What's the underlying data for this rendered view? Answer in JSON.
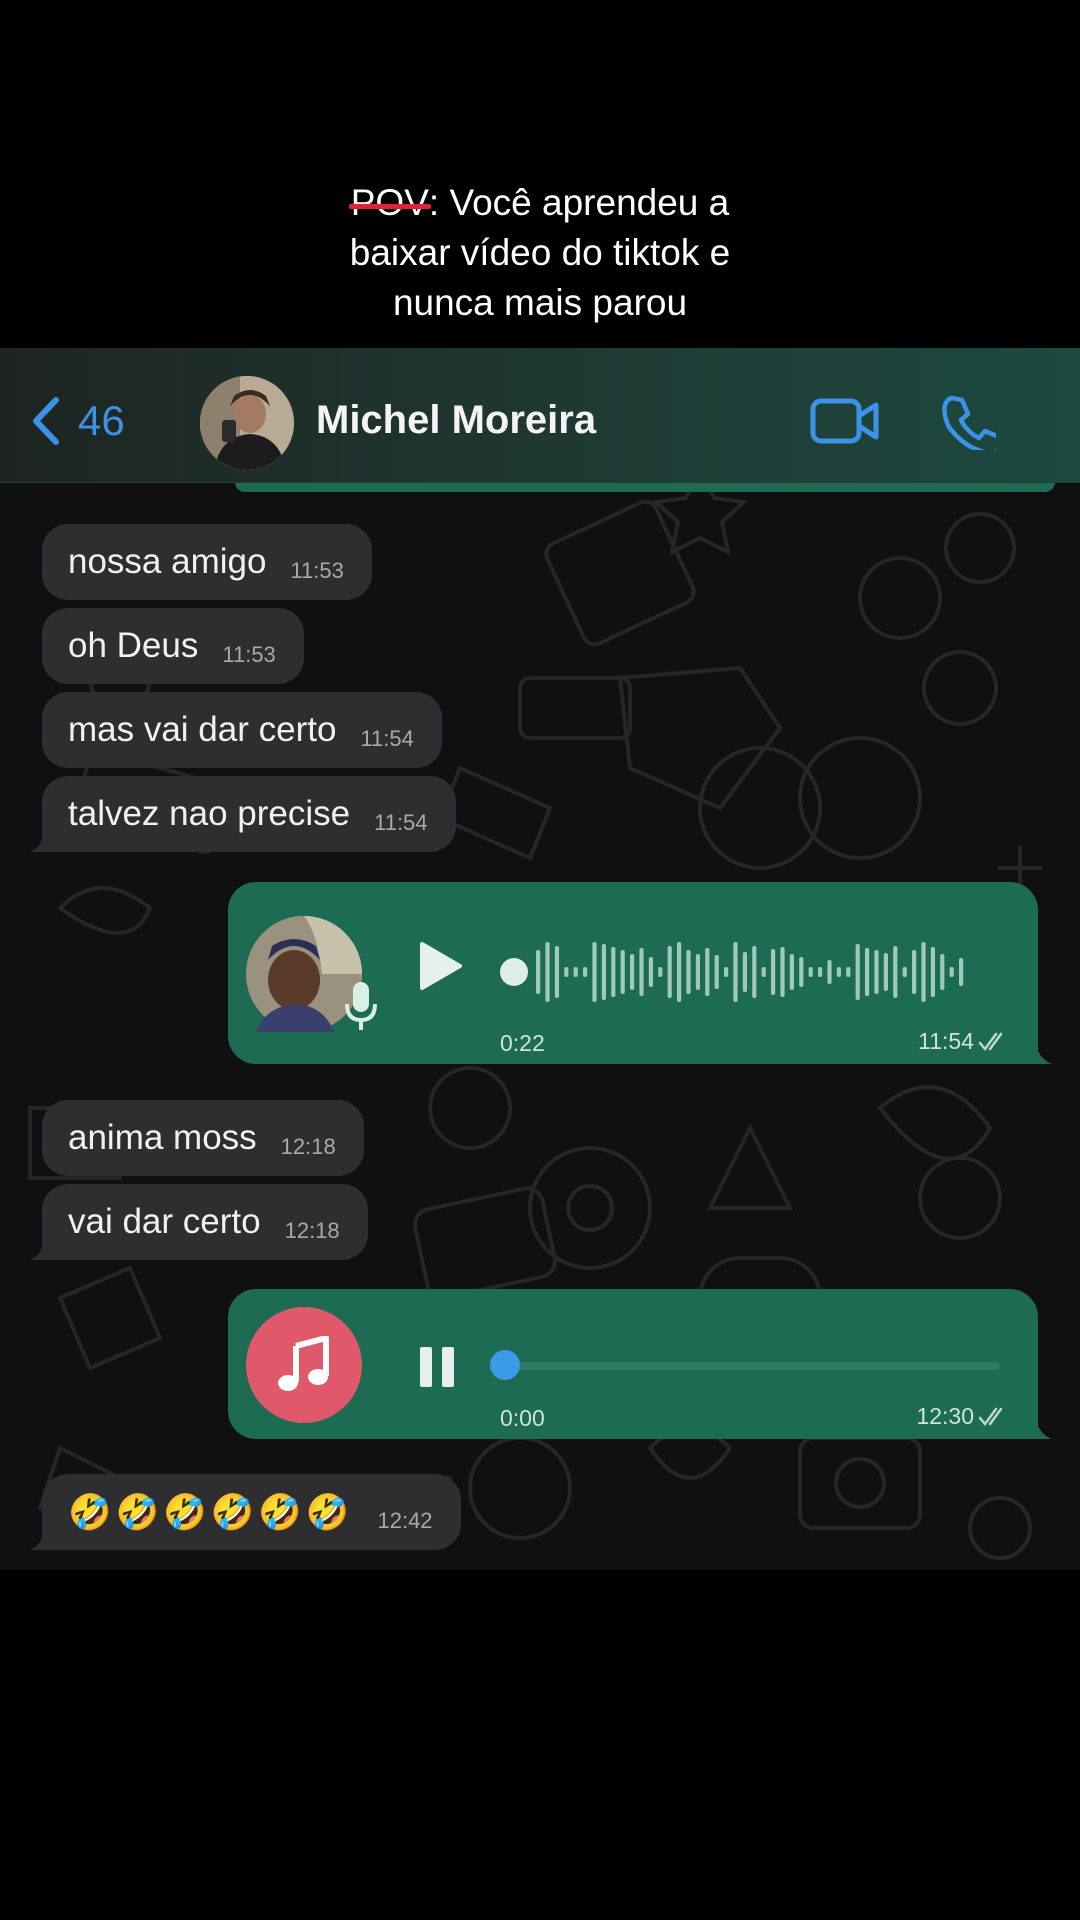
{
  "caption": {
    "strike_word": "POV",
    "line1_rest": ": Você aprendeu a",
    "line2": "baixar vídeo do tiktok e",
    "line3": "nunca mais parou"
  },
  "header": {
    "back_icon": "chevron-left-icon",
    "back_count": "46",
    "contact_name": "Michel Moreira",
    "video_icon": "video-camera-icon",
    "call_icon": "phone-icon",
    "accent": "#3b92e6"
  },
  "messages": {
    "m1": {
      "text": "nossa amigo",
      "time": "11:53"
    },
    "m2": {
      "text": "oh Deus",
      "time": "11:53"
    },
    "m3": {
      "text": "mas vai dar certo",
      "time": "11:54"
    },
    "m4": {
      "text": "talvez nao precise",
      "time": "11:54"
    },
    "voice": {
      "duration": "0:22",
      "time": "11:54",
      "state": "paused",
      "icon": "play-icon"
    },
    "m5": {
      "text": "anima moss",
      "time": "12:18"
    },
    "m6": {
      "text": "vai dar certo",
      "time": "12:18"
    },
    "audio": {
      "duration": "0:00",
      "time": "12:30",
      "state": "playing",
      "icon": "pause-icon",
      "progress": 0
    },
    "m7": {
      "emoji": "🤣🤣🤣🤣🤣🤣",
      "time": "12:42"
    }
  },
  "colors": {
    "incoming_bubble": "#2e2e30",
    "outgoing_bubble": "#1d6b52",
    "music_circle": "#e0596a"
  }
}
